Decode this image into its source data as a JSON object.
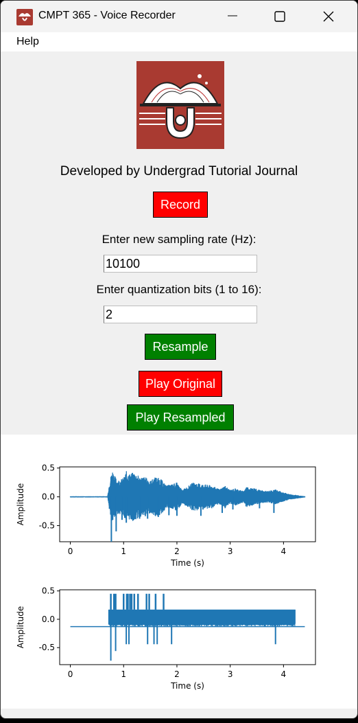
{
  "window": {
    "title": "CMPT 365 - Voice Recorder"
  },
  "menu": {
    "help": "Help"
  },
  "main": {
    "developer_text": "Developed by Undergrad Tutorial Journal",
    "record_label": "Record",
    "sampling_rate_prompt": "Enter new sampling rate (Hz):",
    "sampling_rate_value": "10100",
    "quant_bits_prompt": "Enter quantization bits (1 to 16):",
    "quant_bits_value": "2",
    "resample_label": "Resample",
    "play_original_label": "Play Original",
    "play_resampled_label": "Play Resampled",
    "colors": {
      "red_button": "#ff0000",
      "green_button": "#008000",
      "logo_bg": "#a93a31"
    }
  },
  "chart_data": [
    {
      "type": "line",
      "xlabel": "Time (s)",
      "ylabel": "Amplitude",
      "xlim": [
        -0.2,
        4.6
      ],
      "ylim": [
        -0.78,
        0.52
      ],
      "xticks": [
        0,
        1,
        2,
        3,
        4
      ],
      "yticks": [
        0.5,
        0.0,
        -0.5
      ],
      "color": "#1f77b4",
      "envelope": [
        [
          0,
          0.01
        ],
        [
          0.7,
          0.01
        ],
        [
          0.72,
          0.17
        ],
        [
          0.75,
          0.33
        ],
        [
          0.79,
          0.47
        ],
        [
          0.83,
          0.38
        ],
        [
          0.87,
          0.3
        ],
        [
          0.93,
          0.3
        ],
        [
          1,
          0.33
        ],
        [
          1.05,
          0.45
        ],
        [
          1.1,
          0.4
        ],
        [
          1.2,
          0.43
        ],
        [
          1.3,
          0.35
        ],
        [
          1.4,
          0.35
        ],
        [
          1.5,
          0.28
        ],
        [
          1.6,
          0.35
        ],
        [
          1.7,
          0.31
        ],
        [
          1.8,
          0.2
        ],
        [
          1.9,
          0.22
        ],
        [
          2,
          0.25
        ],
        [
          2.1,
          0.12
        ],
        [
          2.2,
          0.18
        ],
        [
          2.3,
          0.25
        ],
        [
          2.5,
          0.22
        ],
        [
          2.65,
          0.2
        ],
        [
          2.8,
          0.13
        ],
        [
          2.9,
          0.2
        ],
        [
          3,
          0.12
        ],
        [
          3.1,
          0.15
        ],
        [
          3.25,
          0.1
        ],
        [
          3.3,
          0.18
        ],
        [
          3.45,
          0.15
        ],
        [
          3.55,
          0.12
        ],
        [
          3.7,
          0.1
        ],
        [
          3.85,
          0.13
        ],
        [
          4,
          0.08
        ],
        [
          4.1,
          0.05
        ],
        [
          4.25,
          0.03
        ],
        [
          4.4,
          0.01
        ]
      ],
      "deep_troughs": [
        [
          0.77,
          -0.78
        ],
        [
          0.86,
          -0.6
        ],
        [
          0.97,
          -0.4
        ],
        [
          1.05,
          -0.45
        ],
        [
          1.3,
          -0.38
        ],
        [
          1.45,
          -0.38
        ],
        [
          1.65,
          -0.35
        ],
        [
          1.85,
          -0.32
        ],
        [
          2.0,
          -0.33
        ],
        [
          2.45,
          -0.33
        ],
        [
          2.85,
          -0.28
        ],
        [
          3.05,
          -0.22
        ],
        [
          3.55,
          -0.2
        ],
        [
          3.82,
          -0.28
        ]
      ]
    },
    {
      "type": "line",
      "xlabel": "Time (s)",
      "ylabel": "Amplitude",
      "xlim": [
        -0.2,
        4.6
      ],
      "ylim": [
        -0.8,
        0.52
      ],
      "xticks": [
        0,
        1,
        2,
        3,
        4
      ],
      "yticks": [
        0.5,
        0.0,
        -0.5
      ],
      "color": "#1f77b4",
      "baseline": -0.13,
      "level_high": 0.45,
      "level_band_top": 0.17,
      "level_band_bottom": -0.4,
      "band_start": 0.72,
      "band_end": 4.22,
      "spikes": [
        [
          0.76,
          0.45
        ],
        [
          0.82,
          0.45
        ],
        [
          0.85,
          0.45
        ],
        [
          1.0,
          0.45
        ],
        [
          1.06,
          0.45
        ],
        [
          1.08,
          0.45
        ],
        [
          1.12,
          0.45
        ],
        [
          1.15,
          0.45
        ],
        [
          1.2,
          0.45
        ],
        [
          1.27,
          0.45
        ],
        [
          1.43,
          0.45
        ],
        [
          1.48,
          0.45
        ],
        [
          1.6,
          0.45
        ],
        [
          1.75,
          0.45
        ]
      ],
      "troughs": [
        [
          0.76,
          -0.73
        ],
        [
          0.85,
          -0.56
        ],
        [
          1.05,
          -0.44
        ],
        [
          1.1,
          -0.44
        ],
        [
          1.45,
          -0.44
        ],
        [
          1.57,
          -0.44
        ],
        [
          1.63,
          -0.44
        ],
        [
          1.9,
          -0.44
        ],
        [
          3.85,
          -0.44
        ]
      ]
    }
  ]
}
